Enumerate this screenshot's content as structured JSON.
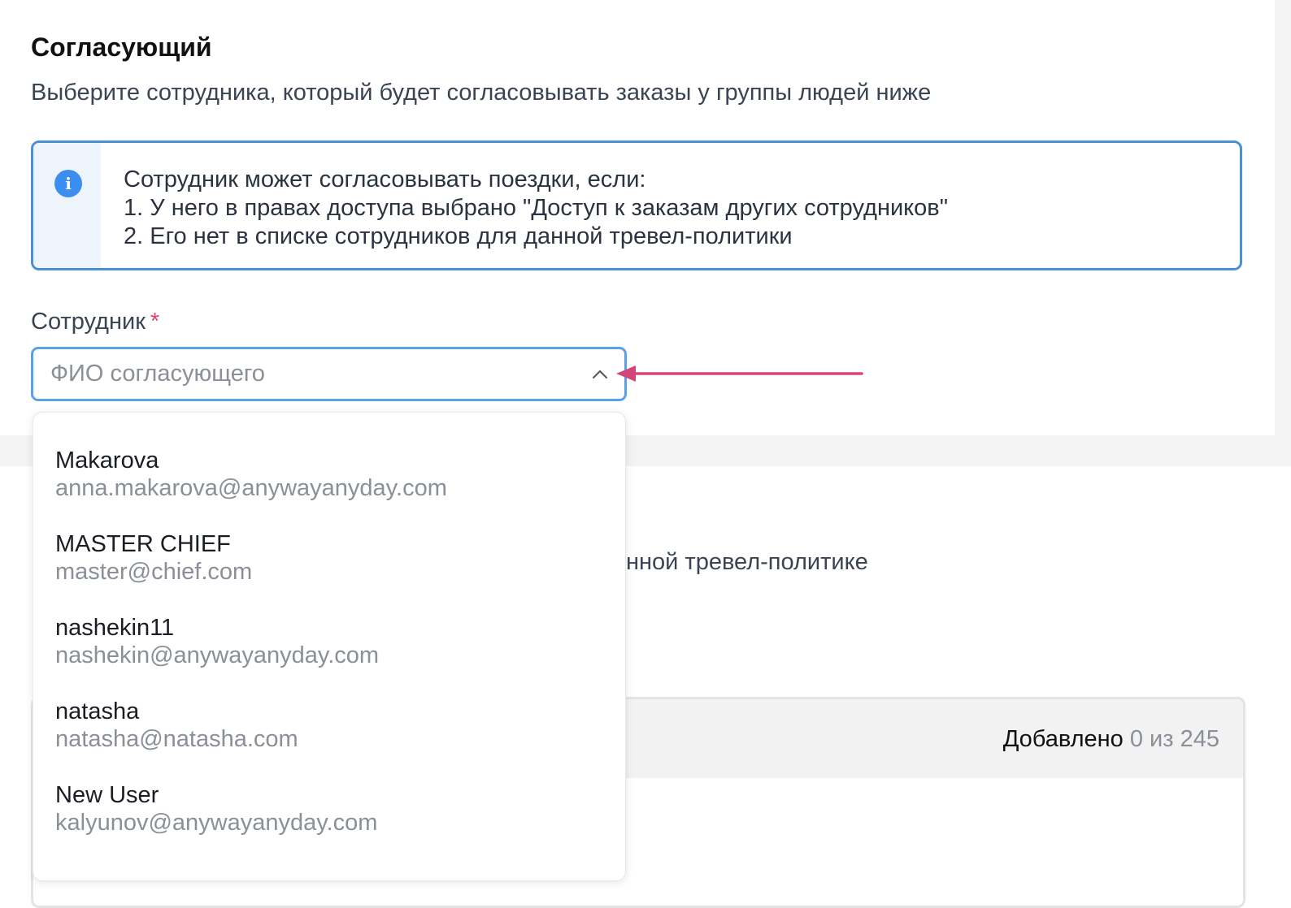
{
  "section": {
    "title": "Согласующий",
    "description": "Выберите сотрудника, который будет согласовывать заказы у группы людей ниже"
  },
  "info": {
    "icon": "info-icon",
    "line1": "Сотрудник может согласовывать поездки, если:",
    "line2": "1. У него в правах доступа выбрано \"Доступ к заказам других сотрудников\"",
    "line3": "2. Его нет в списке сотрудников для данной тревел-политики"
  },
  "employee_field": {
    "label": "Сотрудник",
    "required_mark": "*",
    "placeholder": "ФИО согласующего",
    "value": ""
  },
  "dropdown": {
    "options": [
      {
        "name": "Makarova",
        "email": "anna.makarova@anywayanyday.com"
      },
      {
        "name": "MASTER CHIEF",
        "email": "master@chief.com"
      },
      {
        "name": "nashekin11",
        "email": "nashekin@anywayanyday.com"
      },
      {
        "name": "natasha",
        "email": "natasha@natasha.com"
      },
      {
        "name": "New User",
        "email": "kalyunov@anywayanyday.com"
      }
    ]
  },
  "employees_section": {
    "description_visible": "нной тревел-политике",
    "added_label": "Добавлено",
    "added_count": "0 из 245"
  },
  "colors": {
    "accent_border": "#4a90d9",
    "info_icon": "#3b8ef0",
    "required": "#e0436b",
    "annotation_arrow": "#d4457a"
  }
}
